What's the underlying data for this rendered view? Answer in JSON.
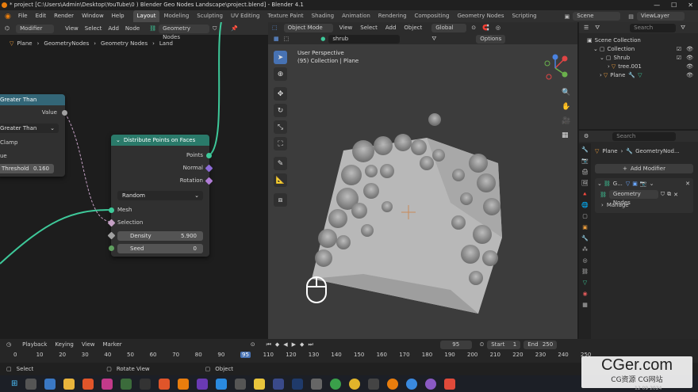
{
  "titlebar": {
    "text": "* project [C:\\Users\\Admin\\Desktop\\YouTube\\0 ) Blender Geo Nodes Landscape\\project.blend] - Blender 4.1",
    "min": "—",
    "max": "☐",
    "close": "✕"
  },
  "menu": [
    "File",
    "Edit",
    "Render",
    "Window",
    "Help"
  ],
  "workspaces": [
    "Layout",
    "Modeling",
    "Sculpting",
    "UV Editing",
    "Texture Paint",
    "Shading",
    "Animation",
    "Rendering",
    "Compositing",
    "Geometry Nodes",
    "Scripting"
  ],
  "active_workspace": "Layout",
  "scene": "Scene",
  "viewlayer": "ViewLayer",
  "nodeeditor": {
    "mode": "Modifier",
    "menus": [
      "View",
      "Select",
      "Add",
      "Node"
    ],
    "tree": "Geometry Nodes",
    "breadcrumb": [
      "Plane",
      "GeometryNodes",
      "Geometry Nodes",
      "Land"
    ],
    "greater": {
      "title": "Greater Than",
      "value": "Value",
      "op": "Greater Than",
      "clamp": "Clamp",
      "ue": "ue",
      "threshold_label": "Threshold",
      "threshold": "0.160"
    },
    "distribute": {
      "title": "Distribute Points on Faces",
      "out_points": "Points",
      "out_normal": "Normal",
      "out_rotation": "Rotation",
      "method": "Random",
      "mesh": "Mesh",
      "selection": "Selection",
      "density_label": "Density",
      "density": "5.900",
      "seed_label": "Seed",
      "seed": "0"
    }
  },
  "viewport": {
    "mode": "Object Mode",
    "menus": [
      "View",
      "Select",
      "Add",
      "Object"
    ],
    "orientation": "Global",
    "search": "shrub",
    "options": "Options",
    "overlay_line1": "User Perspective",
    "overlay_line2": "(95) Collection | Plane"
  },
  "outliner": {
    "search": "Search",
    "items": [
      {
        "label": "Scene Collection"
      },
      {
        "label": "Collection"
      },
      {
        "label": "Shrub"
      },
      {
        "label": "tree.001"
      },
      {
        "label": "Plane"
      }
    ]
  },
  "properties": {
    "search": "Search",
    "crumb1": "Plane",
    "crumb2": "GeometryNod...",
    "add_modifier": "Add Modifier",
    "mod_short": "G...",
    "mod_name": "Geometry Nodes",
    "manage": "Manage"
  },
  "timeline": {
    "menus": [
      "Playback",
      "Keying",
      "View",
      "Marker"
    ],
    "current": "95",
    "start_label": "Start",
    "start": "1",
    "end_label": "End",
    "end": "250",
    "ticks": [
      "0",
      "10",
      "20",
      "30",
      "40",
      "50",
      "60",
      "70",
      "80",
      "90",
      "95",
      "110",
      "120",
      "130",
      "140",
      "150",
      "160",
      "170",
      "180",
      "190",
      "200",
      "210",
      "220",
      "230",
      "240",
      "250"
    ]
  },
  "status": {
    "select": "Select",
    "rotate": "Rotate View",
    "object": "Object"
  },
  "watermark": {
    "main": "CGer.com",
    "sub": "CG资源 CG网站"
  },
  "clock": "12 09 2024",
  "colors": {
    "node_geo_header": "#2a7a6a",
    "node_math_header": "#336677",
    "wire_green": "#3ec99a",
    "accent_blue": "#4772b3"
  }
}
